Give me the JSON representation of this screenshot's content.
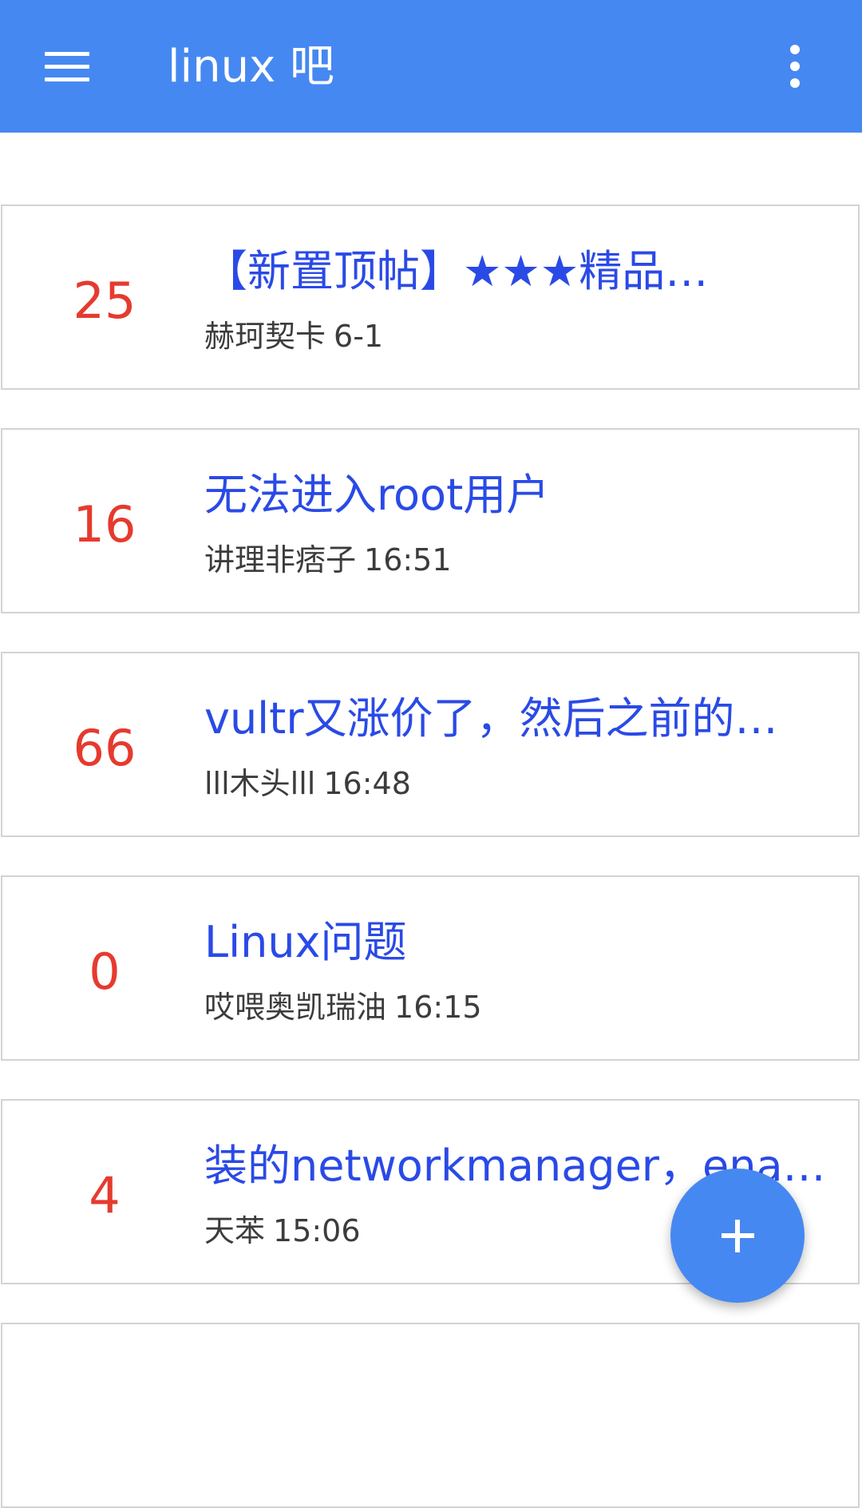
{
  "appbar": {
    "title": "linux 吧",
    "menu_icon": "hamburger-menu-icon",
    "more_icon": "more-vert-icon",
    "color": "#4688f1"
  },
  "posts": [
    {
      "replies": "25",
      "title": "【新置顶帖】★★★精品…",
      "author": "赫珂契卡",
      "time": "6-1"
    },
    {
      "replies": "16",
      "title": "无法进入root用户",
      "author": "讲理非痞子",
      "time": "16:51"
    },
    {
      "replies": "66",
      "title": "vultr又涨价了，然后之前的…",
      "author": "lll木头lll",
      "time": "16:48"
    },
    {
      "replies": "0",
      "title": "Linux问题",
      "author": "哎喂奥凯瑞油",
      "time": "16:15"
    },
    {
      "replies": "4",
      "title": "装的networkmanager，ena…",
      "author": "天苯",
      "time": "15:06"
    }
  ],
  "fab": {
    "icon": "plus-icon",
    "color": "#4688f1"
  },
  "colors": {
    "reply_count": "#e63a2e",
    "post_title": "#2a4ae6",
    "meta": "#3c3c3c"
  }
}
